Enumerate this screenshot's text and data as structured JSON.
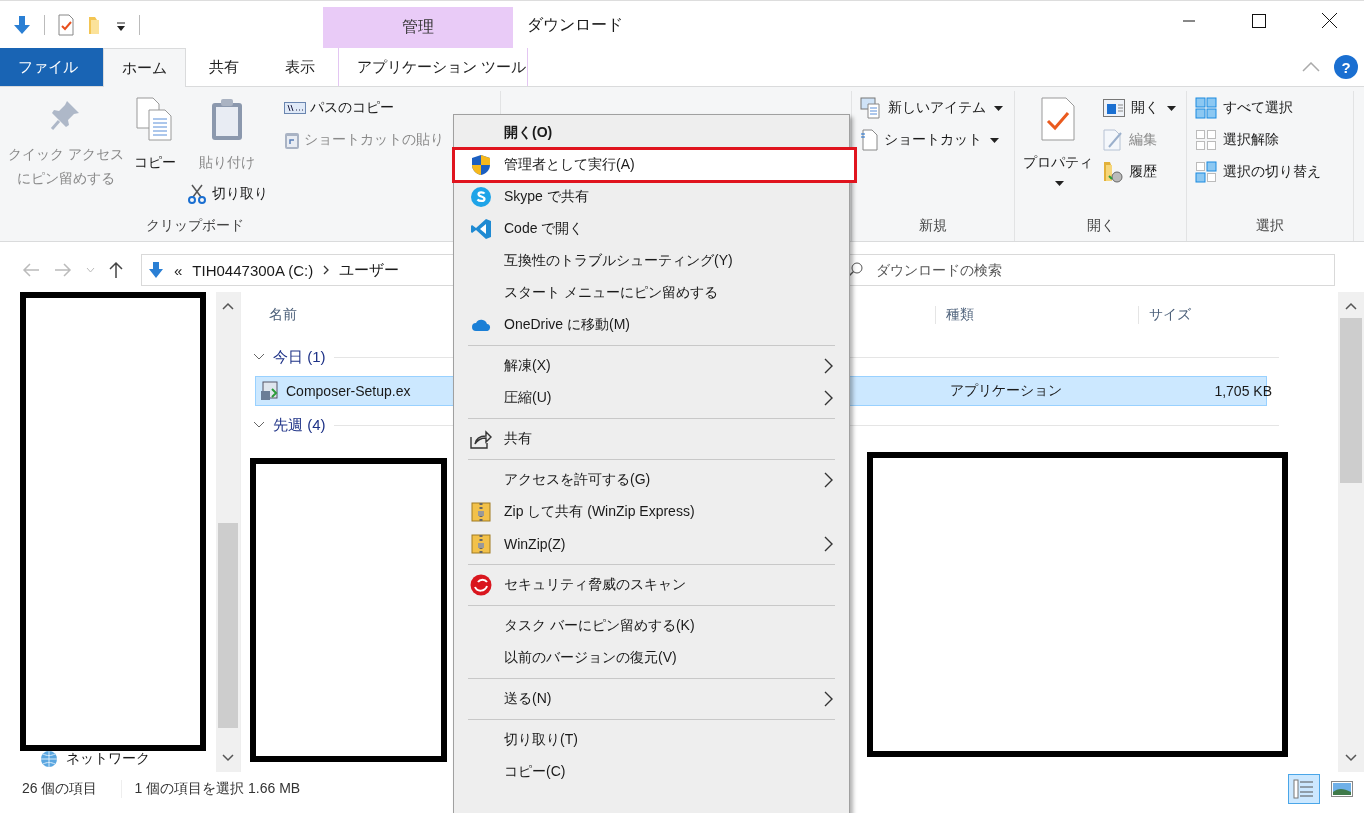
{
  "window": {
    "title": "ダウンロード"
  },
  "context_tab": {
    "label": "管理"
  },
  "tabs": [
    {
      "label": "ファイル",
      "kind": "file",
      "selected": false
    },
    {
      "label": "ホーム",
      "kind": "tab",
      "selected": true
    },
    {
      "label": "共有",
      "kind": "tab",
      "selected": false
    },
    {
      "label": "表示",
      "kind": "tab",
      "selected": false
    },
    {
      "label": "アプリケーション ツール",
      "kind": "context",
      "selected": false
    }
  ],
  "ribbon": {
    "groups": [
      {
        "name": "クリップボード",
        "columns": [
          [
            {
              "label": [
                "クイック アクセス",
                "にピン留めする"
              ],
              "kind": "pin",
              "large": true,
              "disabled": true,
              "dropdown": false
            }
          ],
          [
            {
              "label": "コピー",
              "kind": "copy",
              "large": true,
              "disabled": false,
              "dropdown": false
            }
          ],
          [
            {
              "label": "貼り付け",
              "kind": "paste",
              "large": true,
              "disabled": true,
              "dropdown": false
            },
            {
              "label": "切り取り",
              "kind": "cut",
              "large": false,
              "disabled": false,
              "dropdown": false
            }
          ],
          [
            {
              "label": "パスのコピー",
              "kind": "path",
              "large": false,
              "disabled": false,
              "dropdown": false
            },
            {
              "label": "ショートカットの貼り",
              "kind": "paste-shortcut",
              "large": false,
              "disabled": true,
              "dropdown": false
            }
          ]
        ]
      },
      {
        "name": "新規",
        "columns": [
          [
            {
              "label": "新しいアイテム",
              "kind": "new-item",
              "large": false,
              "disabled": false,
              "dropdown": true
            },
            {
              "label": "ショートカット",
              "kind": "shortcut",
              "large": false,
              "disabled": false,
              "dropdown": true
            }
          ]
        ]
      },
      {
        "name": "開く",
        "columns": [
          [
            {
              "label": "プロパティ",
              "kind": "properties",
              "large": true,
              "disabled": false,
              "dropdown": true
            }
          ],
          [
            {
              "label": "開く",
              "kind": "open",
              "large": false,
              "disabled": false,
              "dropdown": true
            },
            {
              "label": "編集",
              "kind": "edit",
              "large": false,
              "disabled": true,
              "dropdown": false
            },
            {
              "label": "履歴",
              "kind": "history",
              "large": false,
              "disabled": false,
              "dropdown": false
            }
          ]
        ]
      },
      {
        "name": "選択",
        "columns": [
          [
            {
              "label": "すべて選択",
              "kind": "select-all",
              "large": false,
              "disabled": false,
              "dropdown": false
            },
            {
              "label": "選択解除",
              "kind": "select-none",
              "large": false,
              "disabled": false,
              "dropdown": false
            },
            {
              "label": "選択の切り替え",
              "kind": "invert",
              "large": false,
              "disabled": false,
              "dropdown": false
            }
          ]
        ]
      }
    ]
  },
  "address": {
    "prefix": "«",
    "crumbs": [
      "TIH0447300A (C:)",
      "ユーザー"
    ]
  },
  "search": {
    "placeholder": "ダウンロードの検索"
  },
  "help": {
    "label": "?"
  },
  "nav_pane": {
    "items": [
      {
        "label": "ネットワーク"
      }
    ]
  },
  "file_list": {
    "columns": [
      "名前",
      "種類",
      "サイズ"
    ],
    "groups": [
      {
        "label": "今日 (1)",
        "expanded": true,
        "rows": [
          {
            "name": "Composer-Setup.ex",
            "type": "アプリケーション",
            "size": "1,705 KB",
            "selected": true
          }
        ]
      },
      {
        "label": "先週 (4)",
        "expanded": true
      }
    ]
  },
  "status_bar": {
    "count": "26 個の項目",
    "selection": "1 個の項目を選択  1.66 MB",
    "views": [
      {
        "kind": "details",
        "selected": true
      },
      {
        "kind": "large-icons",
        "selected": false
      }
    ]
  },
  "menu": {
    "items": [
      {
        "kind": "plain",
        "label": "開く(O)",
        "default": true,
        "highlighted": false,
        "submenu": false
      },
      {
        "kind": "shield",
        "label": "管理者として実行(A)",
        "default": false,
        "highlighted": true,
        "submenu": false
      },
      {
        "kind": "skype",
        "label": "Skype で共有",
        "default": false,
        "highlighted": false,
        "submenu": false
      },
      {
        "kind": "code",
        "label": "Code で開く",
        "default": false,
        "highlighted": false,
        "submenu": false
      },
      {
        "kind": "plain",
        "label": "互換性のトラブルシューティング(Y)",
        "default": false,
        "highlighted": false,
        "submenu": false
      },
      {
        "kind": "plain",
        "label": "スタート メニューにピン留めする",
        "default": false,
        "highlighted": false,
        "submenu": false
      },
      {
        "kind": "cloud",
        "label": "OneDrive に移動(M)",
        "default": false,
        "highlighted": false,
        "submenu": false
      },
      {
        "kind": "separator"
      },
      {
        "kind": "plain",
        "label": "解凍(X)",
        "default": false,
        "highlighted": false,
        "submenu": true
      },
      {
        "kind": "plain",
        "label": "圧縮(U)",
        "default": false,
        "highlighted": false,
        "submenu": true
      },
      {
        "kind": "separator"
      },
      {
        "kind": "share",
        "label": "共有",
        "default": false,
        "highlighted": false,
        "submenu": false
      },
      {
        "kind": "separator"
      },
      {
        "kind": "plain",
        "label": "アクセスを許可する(G)",
        "default": false,
        "highlighted": false,
        "submenu": true
      },
      {
        "kind": "zip",
        "label": "Zip して共有 (WinZip Express)",
        "default": false,
        "highlighted": false,
        "submenu": false
      },
      {
        "kind": "zip",
        "label": "WinZip(Z)",
        "default": false,
        "highlighted": false,
        "submenu": true
      },
      {
        "kind": "separator"
      },
      {
        "kind": "security",
        "label": "セキュリティ脅威のスキャン",
        "default": false,
        "highlighted": false,
        "submenu": false
      },
      {
        "kind": "separator"
      },
      {
        "kind": "plain",
        "label": "タスク バーにピン留めする(K)",
        "default": false,
        "highlighted": false,
        "submenu": false
      },
      {
        "kind": "plain",
        "label": "以前のバージョンの復元(V)",
        "default": false,
        "highlighted": false,
        "submenu": false
      },
      {
        "kind": "separator"
      },
      {
        "kind": "plain",
        "label": "送る(N)",
        "default": false,
        "highlighted": false,
        "submenu": true
      },
      {
        "kind": "separator"
      },
      {
        "kind": "plain",
        "label": "切り取り(T)",
        "default": false,
        "highlighted": false,
        "submenu": false
      },
      {
        "kind": "plain",
        "label": "コピー(C)",
        "default": false,
        "highlighted": false,
        "submenu": false
      }
    ]
  }
}
